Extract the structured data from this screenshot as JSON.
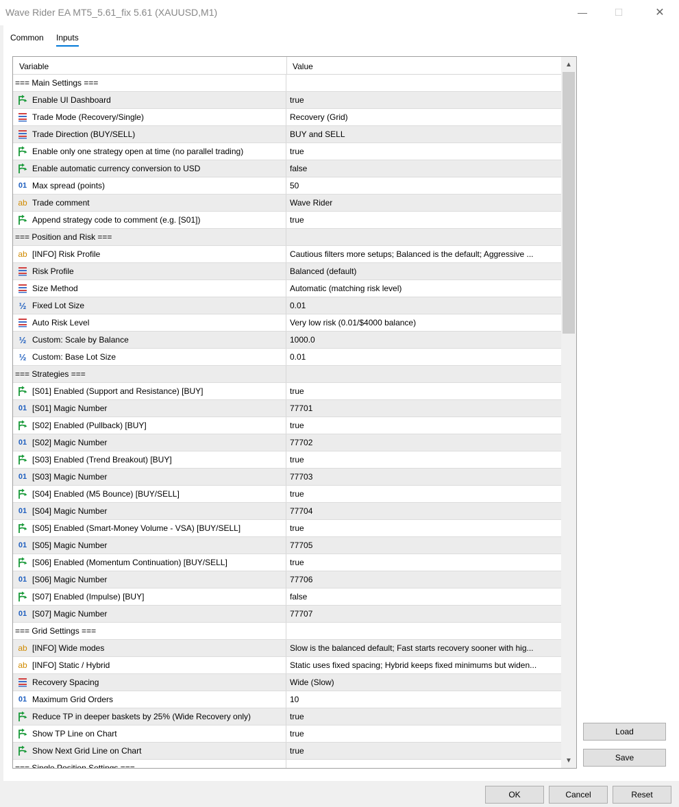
{
  "window": {
    "title": "Wave Rider EA MT5_5.61_fix 5.61 (XAUUSD,M1)",
    "minimize": "—",
    "maximize": "☐",
    "close": "✕"
  },
  "tabs": [
    {
      "label": "Common"
    },
    {
      "label": "Inputs"
    }
  ],
  "grid": {
    "columns": {
      "variable": "Variable",
      "value": "Value"
    },
    "rows": [
      {
        "type": "section",
        "name": "=== Main Settings ===",
        "value": ""
      },
      {
        "type": "bool",
        "name": "Enable UI Dashboard",
        "value": "true"
      },
      {
        "type": "enum",
        "name": "Trade Mode (Recovery/Single)",
        "value": "Recovery (Grid)"
      },
      {
        "type": "enum",
        "name": "Trade Direction (BUY/SELL)",
        "value": "BUY and SELL"
      },
      {
        "type": "bool",
        "name": "Enable only one strategy open at time (no parallel trading)",
        "value": "true"
      },
      {
        "type": "bool",
        "name": "Enable automatic currency conversion to USD",
        "value": "false"
      },
      {
        "type": "int",
        "name": "Max spread (points)",
        "value": "50"
      },
      {
        "type": "string",
        "name": "Trade comment",
        "value": "Wave Rider"
      },
      {
        "type": "bool",
        "name": "Append strategy code to comment (e.g. [S01])",
        "value": "true"
      },
      {
        "type": "section",
        "name": "=== Position and Risk ===",
        "value": ""
      },
      {
        "type": "string",
        "name": "[INFO] Risk Profile",
        "value": "Cautious filters more setups; Balanced is the default; Aggressive ..."
      },
      {
        "type": "enum",
        "name": "Risk Profile",
        "value": "Balanced (default)"
      },
      {
        "type": "enum",
        "name": "Size Method",
        "value": "Automatic (matching risk level)"
      },
      {
        "type": "double",
        "name": "Fixed Lot Size",
        "value": "0.01"
      },
      {
        "type": "enum",
        "name": "Auto Risk Level",
        "value": "Very low risk (0.01/$4000 balance)"
      },
      {
        "type": "double",
        "name": "Custom: Scale by Balance",
        "value": "1000.0"
      },
      {
        "type": "double",
        "name": "Custom: Base Lot Size",
        "value": "0.01"
      },
      {
        "type": "section",
        "name": "=== Strategies ===",
        "value": ""
      },
      {
        "type": "bool",
        "name": "[S01] Enabled (Support and Resistance) [BUY]",
        "value": "true"
      },
      {
        "type": "int",
        "name": "[S01] Magic Number",
        "value": "77701"
      },
      {
        "type": "bool",
        "name": "[S02] Enabled (Pullback) [BUY]",
        "value": "true"
      },
      {
        "type": "int",
        "name": "[S02] Magic Number",
        "value": "77702"
      },
      {
        "type": "bool",
        "name": "[S03] Enabled (Trend Breakout) [BUY]",
        "value": "true"
      },
      {
        "type": "int",
        "name": "[S03] Magic Number",
        "value": "77703"
      },
      {
        "type": "bool",
        "name": "[S04] Enabled (M5 Bounce) [BUY/SELL]",
        "value": "true"
      },
      {
        "type": "int",
        "name": "[S04] Magic Number",
        "value": "77704"
      },
      {
        "type": "bool",
        "name": "[S05] Enabled (Smart-Money Volume - VSA) [BUY/SELL]",
        "value": "true"
      },
      {
        "type": "int",
        "name": "[S05] Magic Number",
        "value": "77705"
      },
      {
        "type": "bool",
        "name": "[S06] Enabled (Momentum Continuation) [BUY/SELL]",
        "value": "true"
      },
      {
        "type": "int",
        "name": "[S06] Magic Number",
        "value": "77706"
      },
      {
        "type": "bool",
        "name": "[S07] Enabled (Impulse) [BUY]",
        "value": "false"
      },
      {
        "type": "int",
        "name": "[S07] Magic Number",
        "value": "77707"
      },
      {
        "type": "section",
        "name": "=== Grid Settings ===",
        "value": ""
      },
      {
        "type": "string",
        "name": "[INFO] Wide modes",
        "value": "Slow is the balanced default; Fast starts recovery sooner with hig..."
      },
      {
        "type": "string",
        "name": "[INFO] Static / Hybrid",
        "value": "Static uses fixed spacing; Hybrid keeps fixed minimums but widen..."
      },
      {
        "type": "enum",
        "name": "Recovery Spacing",
        "value": "Wide (Slow)"
      },
      {
        "type": "int",
        "name": "Maximum Grid Orders",
        "value": "10"
      },
      {
        "type": "bool",
        "name": "Reduce TP in deeper baskets by 25% (Wide Recovery only)",
        "value": "true"
      },
      {
        "type": "bool",
        "name": "Show TP Line on Chart",
        "value": "true"
      },
      {
        "type": "bool",
        "name": "Show Next Grid Line on Chart",
        "value": "true"
      },
      {
        "type": "section",
        "name": "=== Single Position Settings ===",
        "value": ""
      }
    ]
  },
  "icons": {
    "int": "01",
    "string": "ab",
    "double": "½"
  },
  "colors": {
    "accent": "#0078d7",
    "bool_icon": "#1a9a3a",
    "enum_icon_red": "#d04040",
    "enum_icon_blue": "#3a6fc9"
  },
  "side_buttons": {
    "load": "Load",
    "save": "Save"
  },
  "footer_buttons": {
    "ok": "OK",
    "cancel": "Cancel",
    "reset": "Reset"
  }
}
